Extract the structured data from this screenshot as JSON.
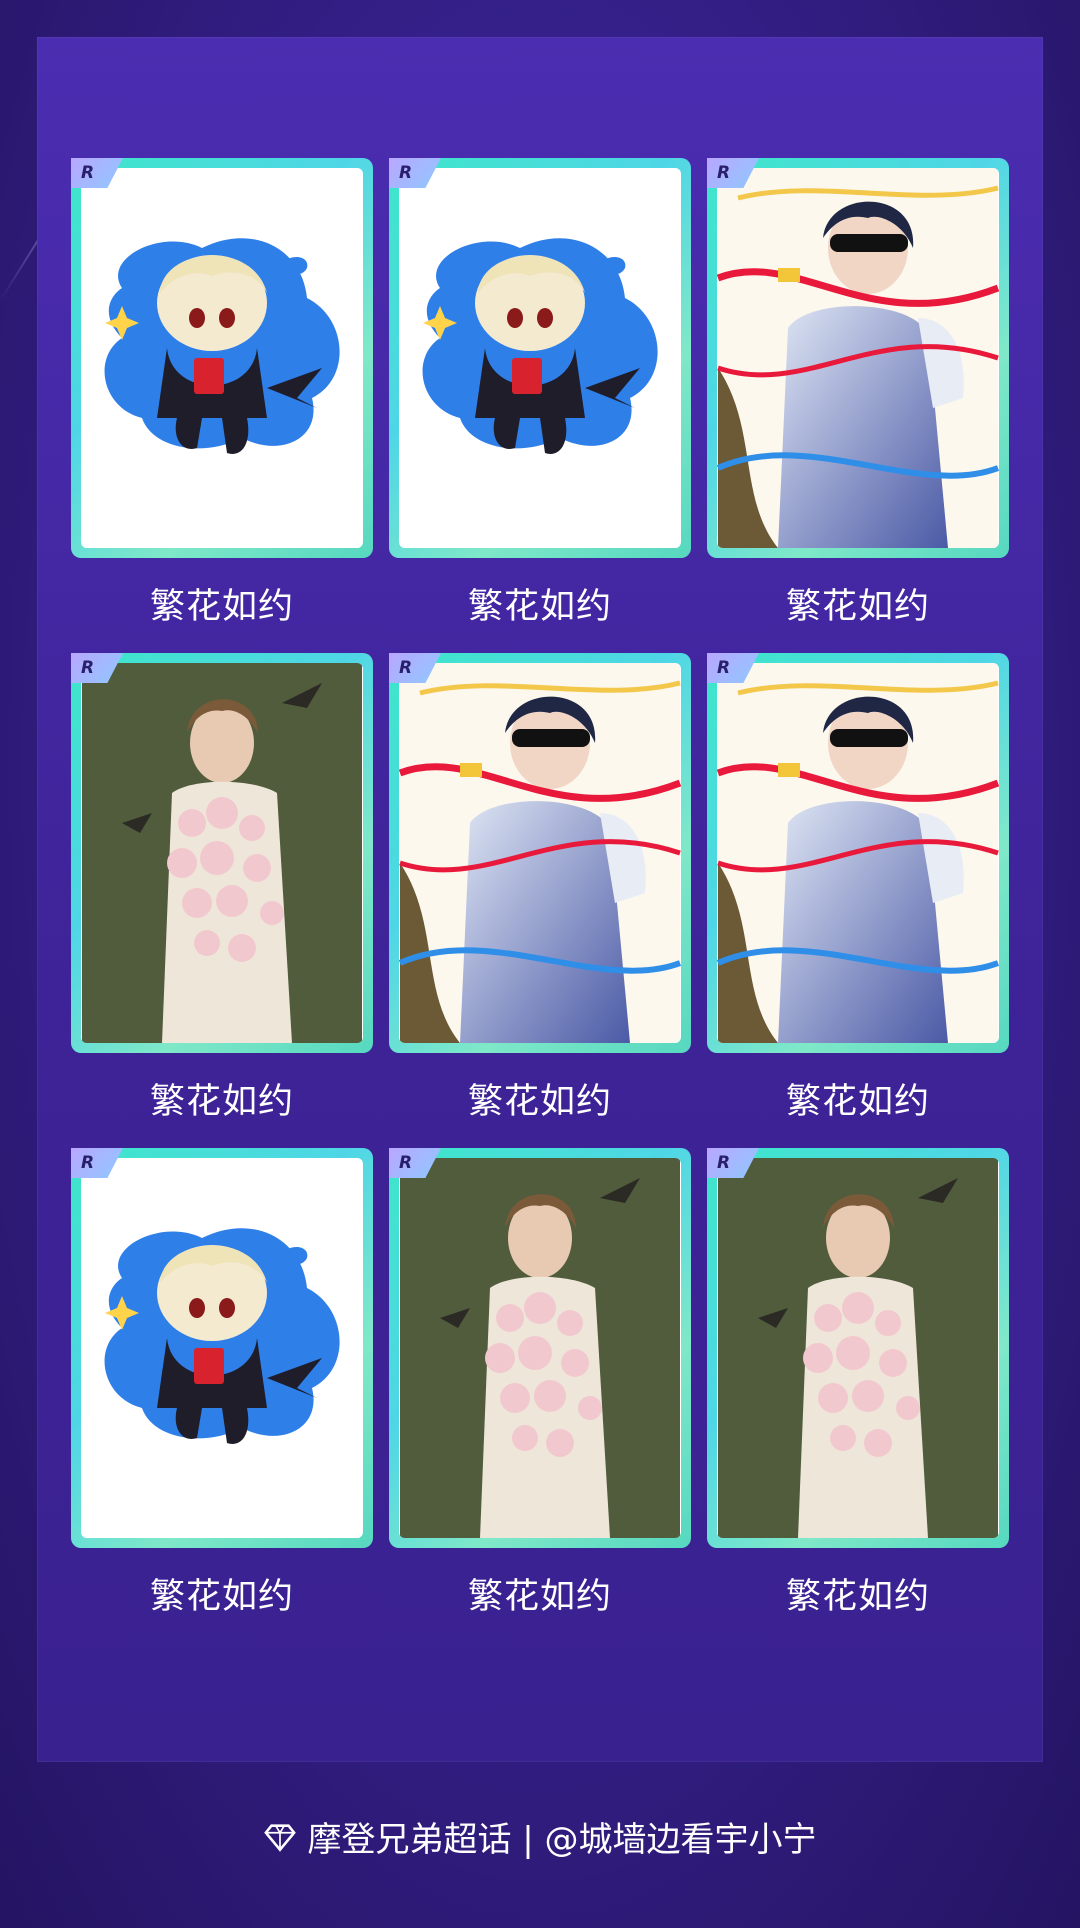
{
  "cards": [
    {
      "rarity": "R",
      "title": "繁花如约",
      "art": "chibi"
    },
    {
      "rarity": "R",
      "title": "繁花如约",
      "art": "chibi"
    },
    {
      "rarity": "R",
      "title": "繁花如约",
      "art": "ribbons"
    },
    {
      "rarity": "R",
      "title": "繁花如约",
      "art": "flowers"
    },
    {
      "rarity": "R",
      "title": "繁花如约",
      "art": "ribbons"
    },
    {
      "rarity": "R",
      "title": "繁花如约",
      "art": "ribbons"
    },
    {
      "rarity": "R",
      "title": "繁花如约",
      "art": "chibi"
    },
    {
      "rarity": "R",
      "title": "繁花如约",
      "art": "flowers"
    },
    {
      "rarity": "R",
      "title": "繁花如约",
      "art": "flowers"
    }
  ],
  "footer": {
    "icon": "diamond-icon",
    "text": "摩登兄弟超话 | @城墙边看宇小宁"
  }
}
